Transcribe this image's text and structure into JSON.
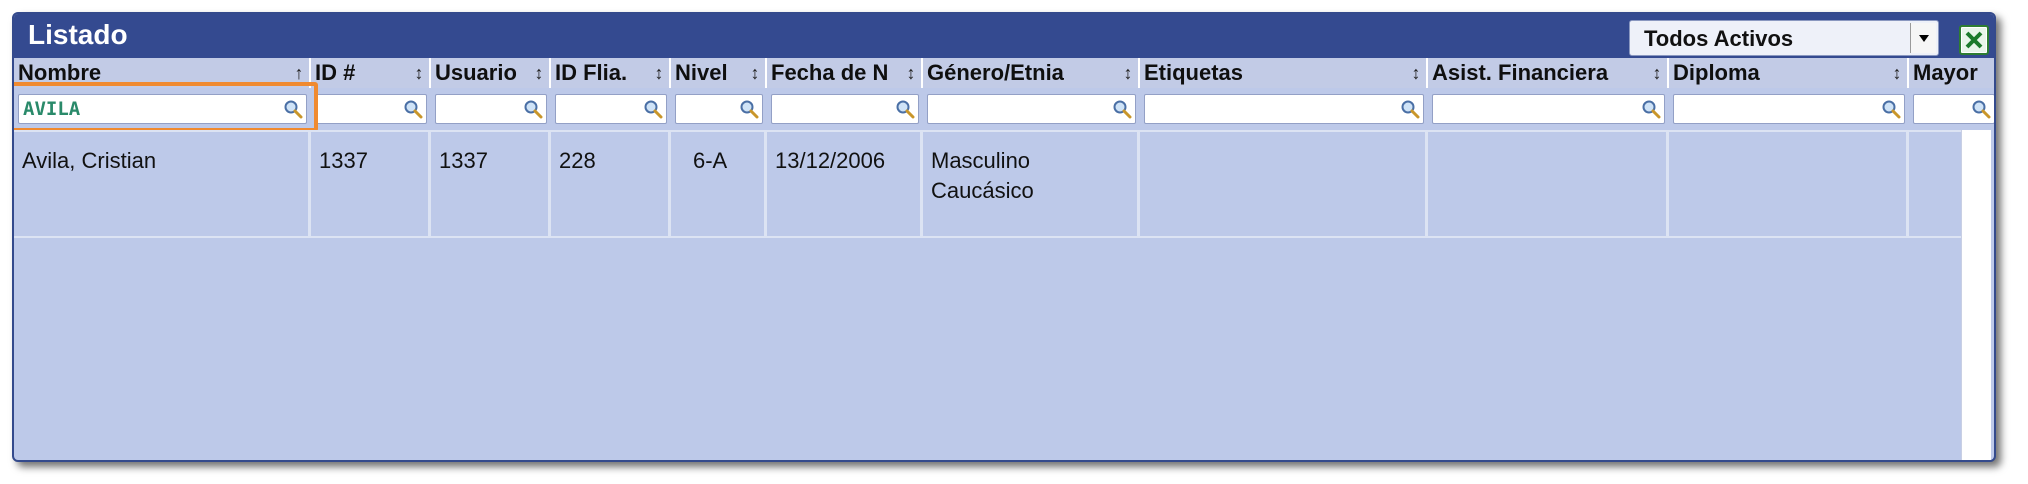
{
  "title": "Listado",
  "status_filter": {
    "selected": "Todos Activos"
  },
  "export_icon": "excel-export-icon",
  "columns": [
    {
      "label": "Nombre",
      "sort": "↑"
    },
    {
      "label": "ID #",
      "sort": "↕"
    },
    {
      "label": "Usuario",
      "sort": "↕"
    },
    {
      "label": "ID Flia.",
      "sort": "↕"
    },
    {
      "label": "Nivel",
      "sort": "↕"
    },
    {
      "label": "Fecha de N",
      "sort": "↕"
    },
    {
      "label": "Género/Etnia",
      "sort": "↕"
    },
    {
      "label": "Etiquetas",
      "sort": "↕"
    },
    {
      "label": "Asist. Financiera",
      "sort": "↕"
    },
    {
      "label": "Diploma",
      "sort": "↕"
    },
    {
      "label": "Mayor",
      "sort": ""
    }
  ],
  "filters": [
    "AVILA",
    "",
    "",
    "",
    "",
    "",
    "",
    "",
    "",
    "",
    ""
  ],
  "rows": [
    {
      "nombre": "Avila, Cristian",
      "id": "1337",
      "usuario": "1337",
      "id_flia": "228",
      "nivel": "6-A",
      "fecha": "13/12/2006",
      "genero": "Masculino",
      "etnia": "Caucásico",
      "etiquetas": "",
      "asist": "",
      "diploma": "",
      "mayor": ""
    }
  ],
  "colors": {
    "titlebar": "#344a90",
    "panel": "#bdc9e9",
    "focus": "#f08a30",
    "filter_text": "#2a8a6a"
  }
}
